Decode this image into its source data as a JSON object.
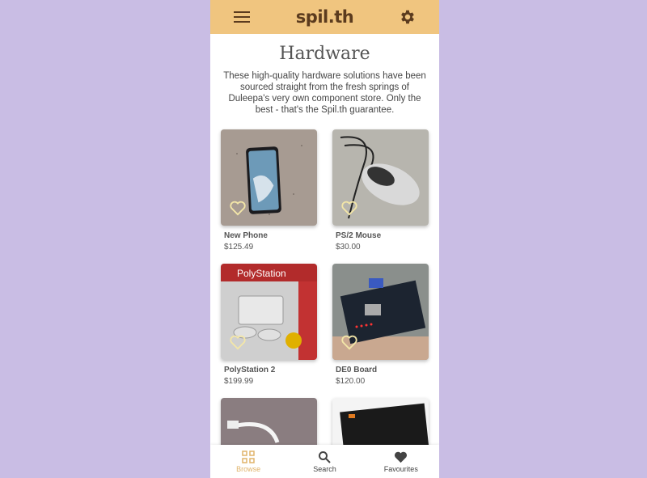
{
  "app": {
    "title": "spil.th",
    "colors": {
      "appbar": "#f0c57f",
      "accent": "#e0b36a",
      "background": "#c9bde4"
    }
  },
  "page": {
    "heading": "Hardware",
    "description": "These high-quality hardware solutions have been sourced straight from the fresh springs of Duleepa's very own component store. Only the best - that's the Spil.th guarantee."
  },
  "products": [
    {
      "name": "New Phone",
      "price": "$125.49",
      "favorite_icon": "heart-outline-icon"
    },
    {
      "name": "PS/2 Mouse",
      "price": "$30.00",
      "favorite_icon": "heart-outline-icon"
    },
    {
      "name": "PolyStation 2",
      "price": "$199.99",
      "favorite_icon": "heart-outline-icon"
    },
    {
      "name": "DE0 Board",
      "price": "$120.00",
      "favorite_icon": "heart-outline-icon"
    },
    {
      "name": "",
      "price": ""
    },
    {
      "name": "",
      "price": ""
    }
  ],
  "product_images": {
    "polystation_box_text": "PolyStation"
  },
  "nav": {
    "items": [
      {
        "label": "Browse",
        "icon": "grid-icon",
        "active": true
      },
      {
        "label": "Search",
        "icon": "search-icon",
        "active": false
      },
      {
        "label": "Favourites",
        "icon": "heart-icon",
        "active": false
      }
    ]
  }
}
